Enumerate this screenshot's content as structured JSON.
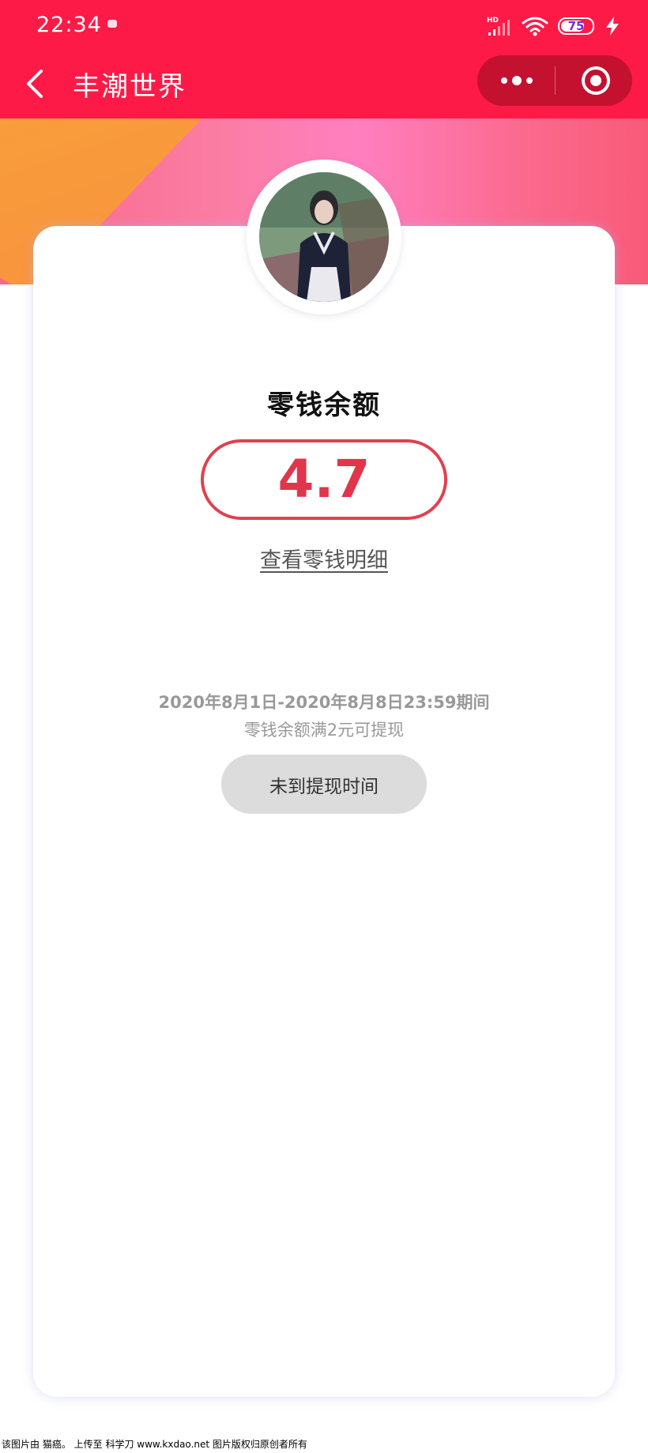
{
  "status_bar": {
    "time": "22:34",
    "network": "HD",
    "battery_level": 75,
    "battery_text": "75"
  },
  "nav": {
    "title": "丰潮世界",
    "icons": [
      "back-icon",
      "more-icon",
      "close-icon"
    ]
  },
  "colors": {
    "brand_red": "#fe1a47",
    "balance_red": "#e0354a",
    "hero_orange": "#f7a23a",
    "hero_pink": "#ff7fbf"
  },
  "balance": {
    "title": "零钱余额",
    "value": "4.7",
    "detail_link": "查看零钱明细"
  },
  "withdraw": {
    "period": "2020年8月1日-2020年8月8日23:59期间",
    "rule": "零钱余额满2元可提现",
    "button_label": "未到提现时间"
  },
  "footer": {
    "watermark": "该图片由 猫癌。 上传至 科学刀 www.kxdao.net 图片版权归原创者所有"
  }
}
